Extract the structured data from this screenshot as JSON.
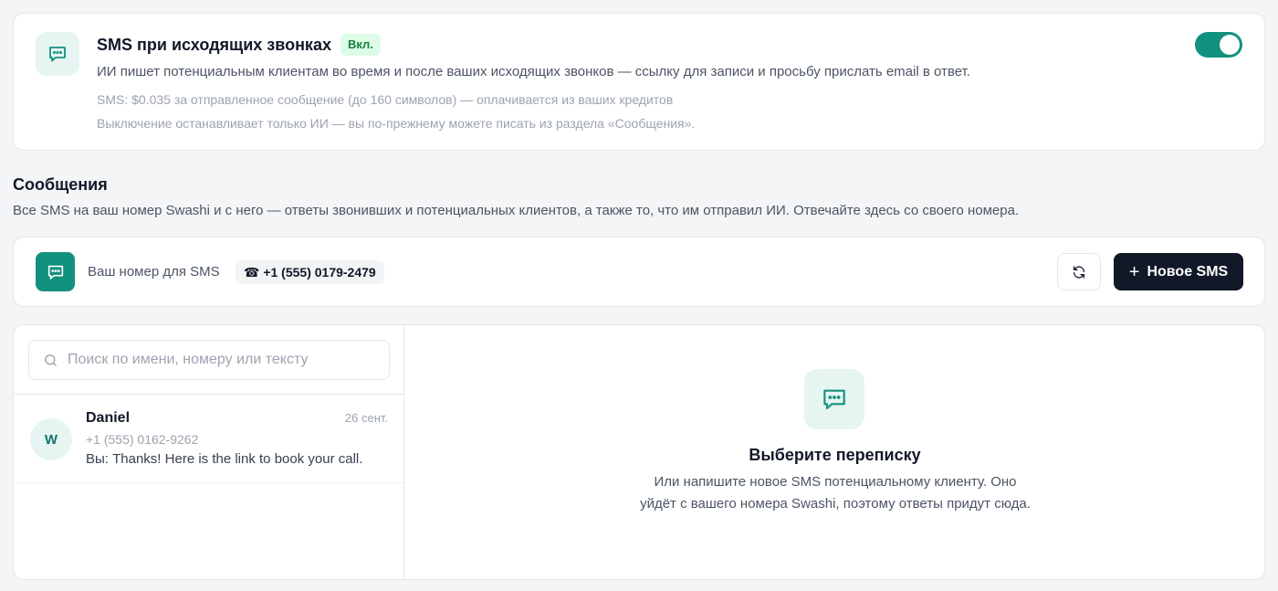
{
  "sms_setting": {
    "title": "SMS при исходящих звонках",
    "status_badge": "Вкл.",
    "description": "ИИ пишет потенциальным клиентам во время и после ваших исходящих звонков — ссылку для записи и просьбу прислать email в ответ.",
    "price_note": "SMS: $0.035 за отправленное сообщение (до 160 символов) — оплачивается из ваших кредитов",
    "disable_note": "Выключение останавливает только ИИ — вы по-прежнему можете писать из раздела «Сообщения».",
    "toggle_on": true,
    "icon": "chat-bubble-icon"
  },
  "messages_section": {
    "title": "Сообщения",
    "description": "Все SMS на ваш номер Swashi и с него — ответы звонивших и потенциальных клиентов, а также то, что им отправил ИИ. Отвечайте здесь со своего номера."
  },
  "number_bar": {
    "label": "Ваш номер для SMS",
    "phone": "☎ +1 (555) 0179-2479",
    "refresh_icon": "refresh-icon",
    "new_sms_label": "Новое SMS",
    "new_sms_icon": "plus-icon"
  },
  "search": {
    "placeholder": "Поиск по имени, номеру или тексту",
    "value": ""
  },
  "conversations": [
    {
      "avatar": "W",
      "name": "Daniel",
      "date": "26 сент.",
      "phone": "+1 (555) 0162-9262",
      "last_message": "Вы: Thanks! Here is the link to book your call."
    }
  ],
  "empty_state": {
    "title": "Выберите переписку",
    "description": "Или напишите новое SMS потенциальному клиенту. Оно уйдёт с вашего номера Swashi, поэтому ответы придут сюда."
  },
  "colors": {
    "accent": "#12917e",
    "accent_light": "#e6f5f2",
    "dark_button": "#111827",
    "badge_bg": "#dcfce7",
    "badge_text": "#15803d"
  }
}
